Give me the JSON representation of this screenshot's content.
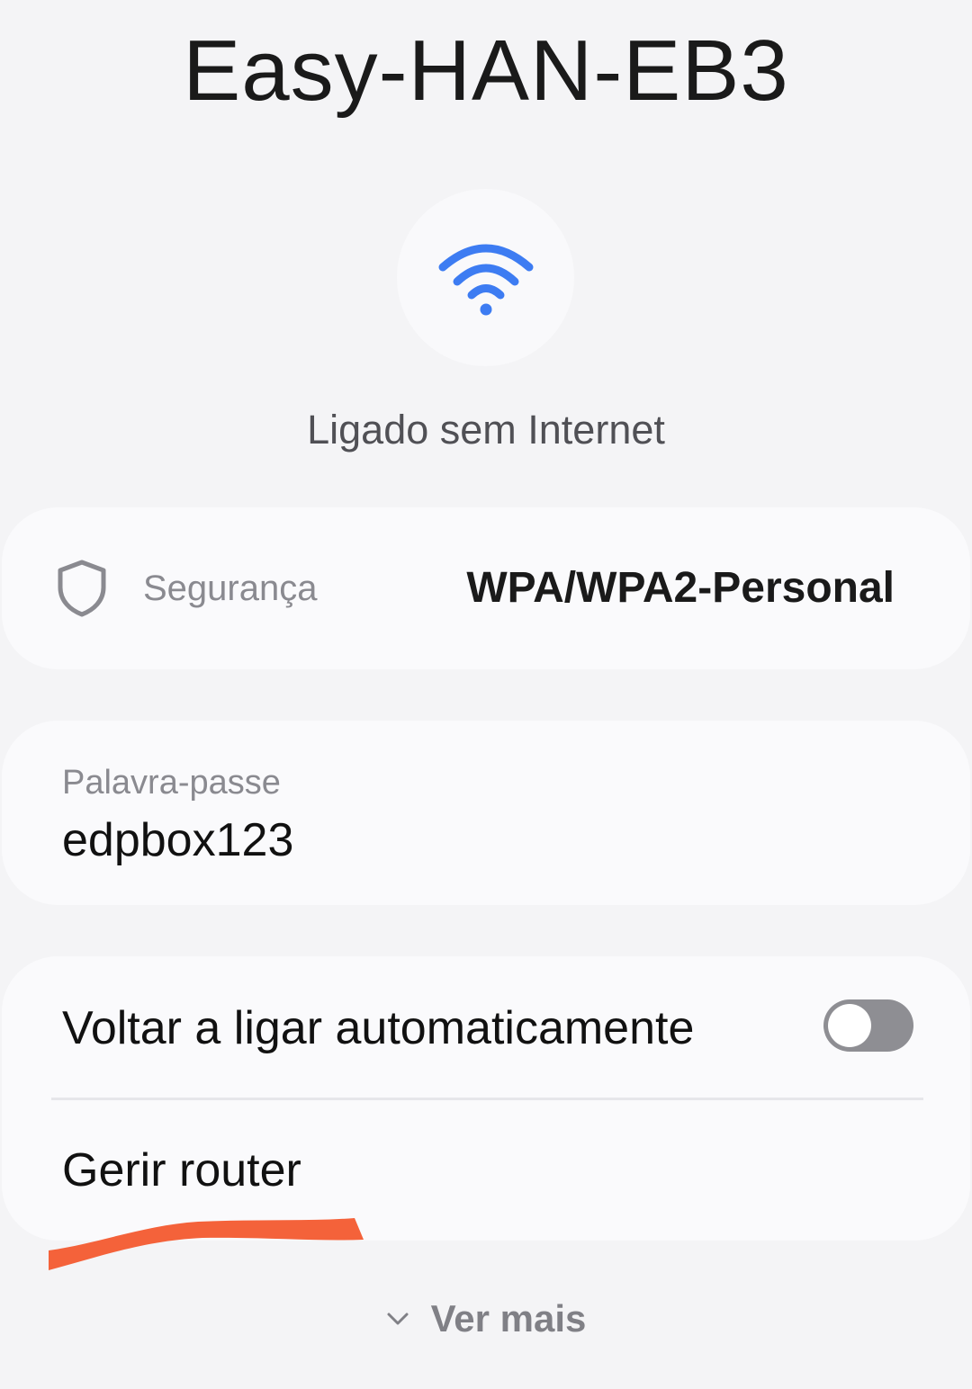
{
  "network": {
    "name": "Easy-HAN-EB3",
    "status": "Ligado sem Internet",
    "icon": "wifi-icon"
  },
  "security": {
    "label": "Segurança",
    "value": "WPA/WPA2-Personal",
    "icon": "shield-icon"
  },
  "password": {
    "label": "Palavra-passe",
    "value": "edpbox123"
  },
  "options": {
    "auto_reconnect_label": "Voltar a ligar automaticamente",
    "auto_reconnect_enabled": false,
    "manage_router_label": "Gerir router"
  },
  "footer": {
    "see_more_label": "Ver mais",
    "icon": "chevron-down-icon"
  },
  "colors": {
    "background": "#f4f4f6",
    "card": "#fafafc",
    "wifi_accent": "#3d7cf2",
    "annotation": "#f4623a",
    "toggle_off": "#8e8e93"
  }
}
